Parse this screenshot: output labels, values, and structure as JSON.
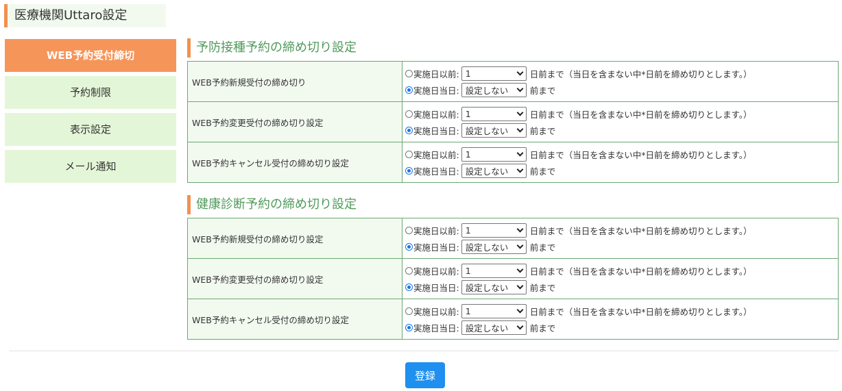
{
  "page_title": "医療機関Uttaro設定",
  "sidebar": {
    "items": [
      {
        "label": "WEB予約受付締切",
        "active": true
      },
      {
        "label": "予約制限",
        "active": false
      },
      {
        "label": "表示設定",
        "active": false
      },
      {
        "label": "メール通知",
        "active": false
      }
    ]
  },
  "sections": [
    {
      "title": "予防接種予約の締め切り設定",
      "rows": [
        {
          "label": "WEB予約新規受付の締め切り",
          "opt1_label": "実施日以前:",
          "opt1_value": "1",
          "opt1_suffix": "日前まで（当日を含まない中*日前を締め切りとします。）",
          "opt2_label": "実施日当日:",
          "opt2_value": "設定しない",
          "opt2_suffix": "前まで",
          "selected": 2
        },
        {
          "label": "WEB予約変更受付の締め切り設定",
          "opt1_label": "実施日以前:",
          "opt1_value": "1",
          "opt1_suffix": "日前まで（当日を含まない中*日前を締め切りとします。）",
          "opt2_label": "実施日当日:",
          "opt2_value": "設定しない",
          "opt2_suffix": "前まで",
          "selected": 2
        },
        {
          "label": "WEB予約キャンセル受付の締め切り設定",
          "opt1_label": "実施日以前:",
          "opt1_value": "1",
          "opt1_suffix": "日前まで（当日を含まない中*日前を締め切りとします。）",
          "opt2_label": "実施日当日:",
          "opt2_value": "設定しない",
          "opt2_suffix": "前まで",
          "selected": 2
        }
      ]
    },
    {
      "title": "健康診断予約の締め切り設定",
      "rows": [
        {
          "label": "WEB予約新規受付の締め切り設定",
          "opt1_label": "実施日以前:",
          "opt1_value": "1",
          "opt1_suffix": "日前まで（当日を含まない中*日前を締め切りとします。）",
          "opt2_label": "実施日当日:",
          "opt2_value": "設定しない",
          "opt2_suffix": "前まで",
          "selected": 2
        },
        {
          "label": "WEB予約変更受付の締め切り設定",
          "opt1_label": "実施日以前:",
          "opt1_value": "1",
          "opt1_suffix": "日前まで（当日を含まない中*日前を締め切りとします。）",
          "opt2_label": "実施日当日:",
          "opt2_value": "設定しない",
          "opt2_suffix": "前まで",
          "selected": 2
        },
        {
          "label": "WEB予約キャンセル受付の締め切り設定",
          "opt1_label": "実施日以前:",
          "opt1_value": "1",
          "opt1_suffix": "日前まで（当日を含まない中*日前を締め切りとします。）",
          "opt2_label": "実施日当日:",
          "opt2_value": "設定しない",
          "opt2_suffix": "前まで",
          "selected": 2
        }
      ]
    }
  ],
  "submit_label": "登録",
  "colors": {
    "accent_orange": "#f6955a",
    "sidebar_bg": "#e4f6d8",
    "section_title": "#4f9a5a",
    "table_border": "#6aa870",
    "button_blue": "#1f8ff0"
  }
}
